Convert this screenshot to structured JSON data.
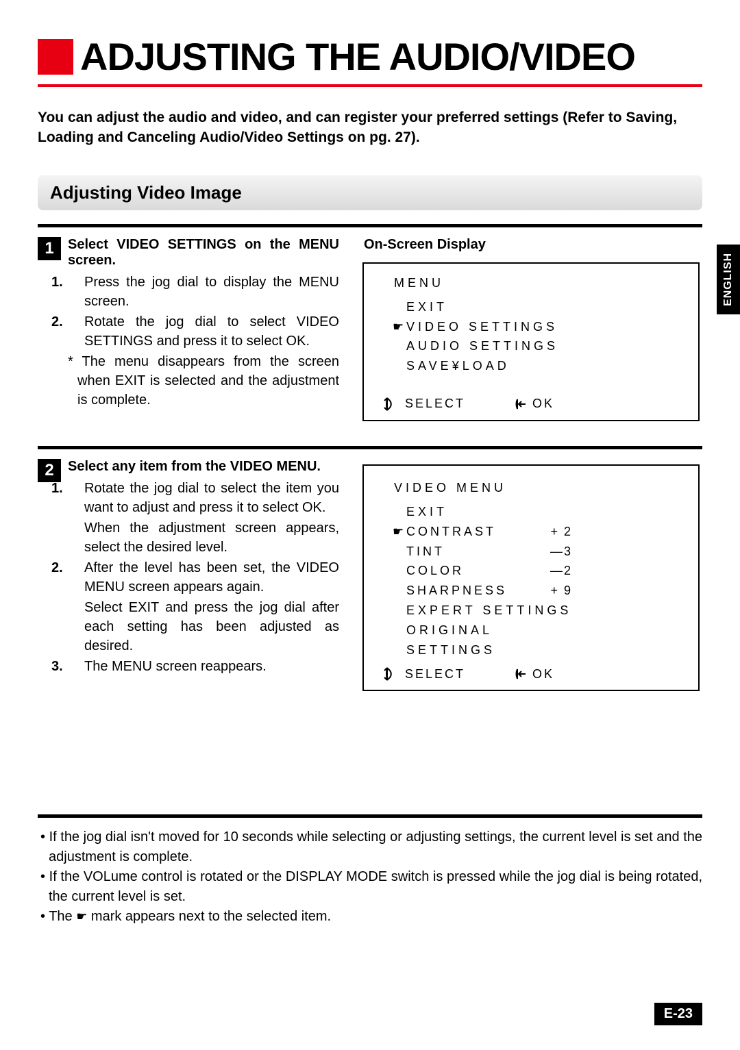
{
  "title": "ADJUSTING THE AUDIO/VIDEO",
  "intro": "You can adjust the audio and video, and can register your preferred settings (Refer to Saving, Loading and Canceling Audio/Video Settings on pg. 27).",
  "section_heading": "Adjusting Video Image",
  "language_tab": "ENGLISH",
  "page_number": "E-23",
  "step1": {
    "num": "1",
    "title": "Select VIDEO SETTINGS on the MENU screen.",
    "sub1_num": "1.",
    "sub1": "Press the jog dial to display the MENU screen.",
    "sub2_num": "2.",
    "sub2": "Rotate the jog dial to select VIDEO SETTINGS and press it to select OK.",
    "note_marker": "*",
    "note": "The menu disappears from the screen when EXIT is selected and the adjustment is complete."
  },
  "osd_label": "On-Screen Display",
  "osd1": {
    "head": "MENU",
    "item1": "EXIT",
    "item2": "VIDEO SETTINGS",
    "item3": "AUDIO SETTINGS",
    "item4": "SAVE¥LOAD",
    "select": "SELECT",
    "ok": "OK"
  },
  "step2": {
    "num": "2",
    "title": "Select any item from the VIDEO MENU.",
    "sub1_num": "1.",
    "sub1a": "Rotate the jog dial to select the item you want to adjust and press it to select OK.",
    "sub1b": "When the adjustment screen appears, select the desired level.",
    "sub2_num": "2.",
    "sub2a": "After the level has been set, the VIDEO MENU screen appears again.",
    "sub2b": "Select EXIT and press the jog dial after each setting has been adjusted as desired.",
    "sub3_num": "3.",
    "sub3": "The MENU screen reappears."
  },
  "osd2": {
    "head": "VIDEO MENU",
    "item1": "EXIT",
    "item2": "CONTRAST",
    "val2": "+ 2",
    "item3": "TINT",
    "val3": "—3",
    "item4": "COLOR",
    "val4": "—2",
    "item5": "SHARPNESS",
    "val5": "+ 9",
    "item6": "EXPERT SETTINGS",
    "item7": "ORIGINAL SETTINGS",
    "select": "SELECT",
    "ok": "OK"
  },
  "notes": {
    "n1": "If the jog dial isn't moved for 10 seconds while selecting or adjusting settings, the current level is set and the adjustment is complete.",
    "n2": "If the VOLume control is rotated or the DISPLAY MODE switch is pressed while the jog dial is being rotated, the current level is set.",
    "n3_pre": "The ",
    "n3_post": " mark appears next to the selected item."
  }
}
